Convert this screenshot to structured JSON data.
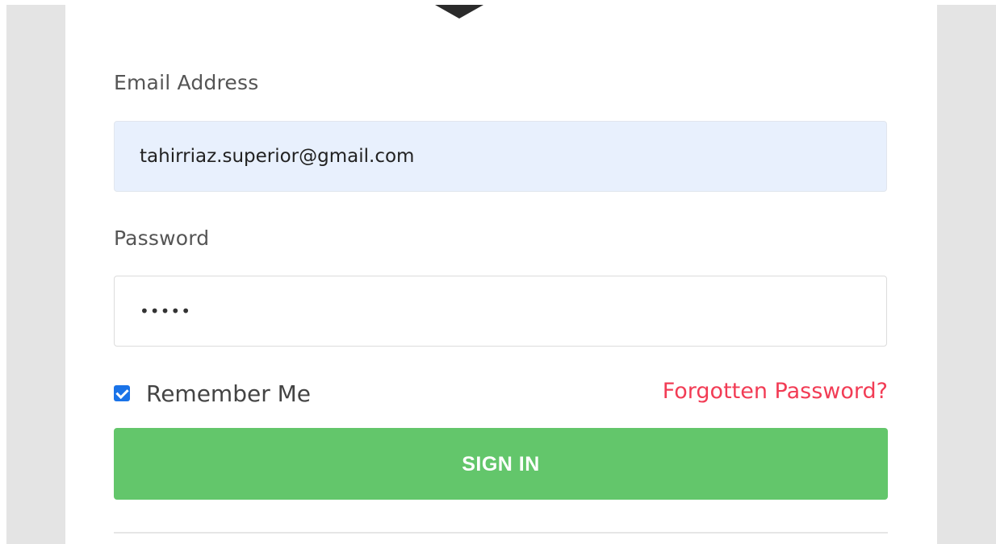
{
  "form": {
    "email_label": "Email Address",
    "email_value": "tahirriaz.superior@gmail.com",
    "password_label": "Password",
    "password_value": "•••••",
    "remember_label": "Remember Me",
    "remember_checked": true,
    "forgot_label": "Forgotten Password?",
    "signin_label": "SIGN IN"
  },
  "colors": {
    "accent_button": "#63c66b",
    "forgot_link": "#f23c55",
    "email_field_bg": "#e8f0fd",
    "checkbox": "#1a73e8"
  }
}
